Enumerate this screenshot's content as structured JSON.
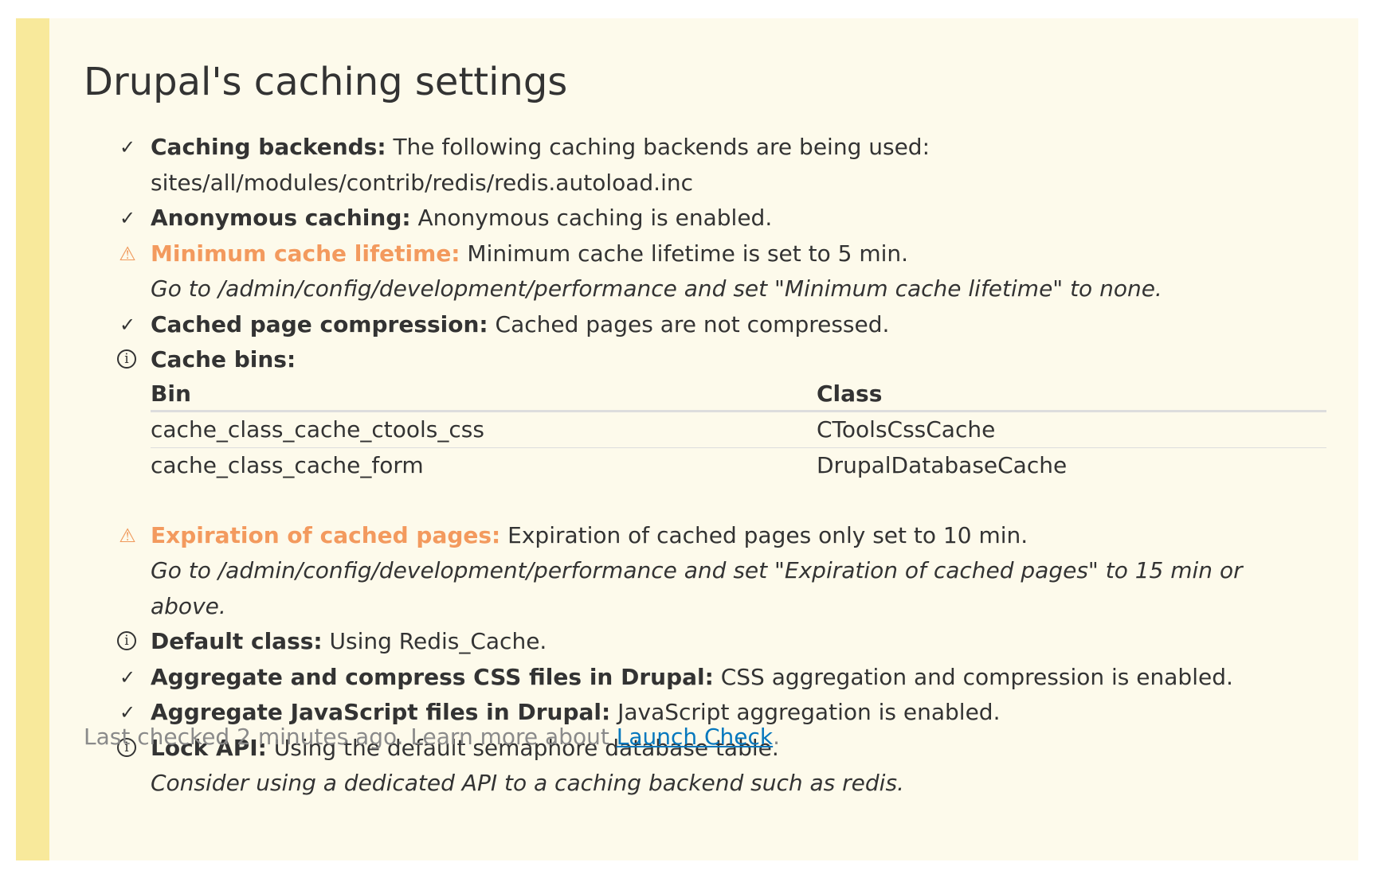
{
  "title": "Drupal's caching settings",
  "icons": {
    "ok": "✓",
    "warn": "⚠",
    "info": "i"
  },
  "colors": {
    "warning": "#f39a5e",
    "link": "#0678be",
    "accent_bar": "#f8e99b",
    "panel_bg": "#fdfaeb"
  },
  "checks": [
    {
      "status": "ok",
      "label": "Caching backends:",
      "text": "The following caching backends are being used:",
      "detail": "sites/all/modules/contrib/redis/redis.autoload.inc"
    },
    {
      "status": "ok",
      "label": "Anonymous caching:",
      "text": "Anonymous caching is enabled."
    },
    {
      "status": "warn",
      "label": "Minimum cache lifetime:",
      "text": "Minimum cache lifetime is set to 5 min.",
      "hint": "Go to /admin/config/development/performance and set \"Minimum cache lifetime\" to none."
    },
    {
      "status": "ok",
      "label": "Cached page compression:",
      "text": "Cached pages are not compressed."
    },
    {
      "status": "info",
      "label": "Cache bins:",
      "table": {
        "headers": [
          "Bin",
          "Class"
        ],
        "rows": [
          [
            "cache_class_cache_ctools_css",
            "CToolsCssCache"
          ],
          [
            "cache_class_cache_form",
            "DrupalDatabaseCache"
          ]
        ]
      }
    },
    {
      "status": "warn",
      "label": "Expiration of cached pages:",
      "text": "Expiration of cached pages only set to 10 min.",
      "hint": "Go to /admin/config/development/performance and set \"Expiration of cached pages\" to 15 min or above."
    },
    {
      "status": "info",
      "label": "Default class:",
      "text": "Using Redis_Cache."
    },
    {
      "status": "ok",
      "label": "Aggregate and compress CSS files in Drupal:",
      "text": "CSS aggregation and compression is enabled."
    },
    {
      "status": "ok",
      "label": "Aggregate JavaScript files in Drupal:",
      "text": "JavaScript aggregation is enabled."
    },
    {
      "status": "info",
      "label": "Lock API:",
      "text": "Using the default semaphore database table.",
      "hint": "Consider using a dedicated API to a caching backend such as redis."
    }
  ],
  "footer": {
    "text": "Last checked 2 minutes ago. Learn more about",
    "link_label": "Launch Check",
    "suffix": "."
  }
}
